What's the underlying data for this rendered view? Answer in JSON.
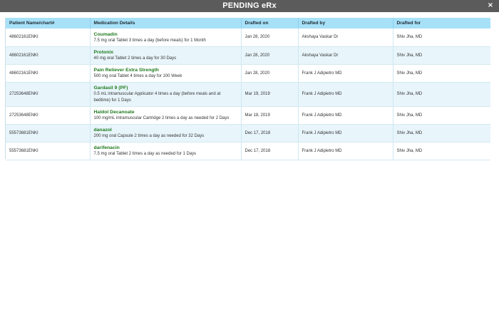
{
  "window": {
    "title": "PENDING eRx",
    "close_glyph": "×",
    "close_icon": "close-icon"
  },
  "table": {
    "columns": [
      "Patient Name/chart#",
      "Medication Details",
      "Drafted on",
      "Drafted by",
      "Drafted for"
    ],
    "rows": [
      {
        "patient": "48602161ENKI",
        "med_name": "Coumadin",
        "med_desc": "7.5 mg oral Tablet 3 times a day (before meals) for 1 Month",
        "drafted_on": "Jan 28, 2020",
        "drafted_by": "Akshaya Vaskar Dr",
        "drafted_for": "Shiv Jha, MD"
      },
      {
        "patient": "48602161ENKI",
        "med_name": "Protonix",
        "med_desc": "40 mg oral Tablet 2 times a day for 30 Days",
        "drafted_on": "Jan 28, 2020",
        "drafted_by": "Akshaya Vaskar Dr",
        "drafted_for": "Shiv Jha, MD"
      },
      {
        "patient": "48602161ENKI",
        "med_name": "Pain Reliever Extra Strength",
        "med_desc": "500 mg oral Tablet 4 times a day for 100 Week",
        "drafted_on": "Jan 28, 2020",
        "drafted_by": "Frank J Adipietro MD",
        "drafted_for": "Shiv Jha, MD"
      },
      {
        "patient": "27253648ENKI",
        "med_name": "Gardasil 9 (PF)",
        "med_desc": "0.5 mL intramuscular Applicator 4 times a day (before meals and at bedtime) for 1 Days",
        "drafted_on": "Mar 19, 2019",
        "drafted_by": "Frank J Adipietro MD",
        "drafted_for": "Shiv Jha, MD"
      },
      {
        "patient": "27253648ENKI",
        "med_name": "Haldol Decanoate",
        "med_desc": "100 mg/mL intramuscular Cartridge 2 times a day as needed for 2 Days",
        "drafted_on": "Mar 18, 2019",
        "drafted_by": "Frank J Adipietro MD",
        "drafted_for": "Shiv Jha, MD"
      },
      {
        "patient": "55573681ENKI",
        "med_name": "danazol",
        "med_desc": "200 mg oral Capsule 2 times a day as needed for 32 Days",
        "drafted_on": "Dec 17, 2018",
        "drafted_by": "Frank J Adipietro MD",
        "drafted_for": "Shiv Jha, MD"
      },
      {
        "patient": "55573681ENKI",
        "med_name": "darifenacin",
        "med_desc": "7.5 mg oral Tablet 2 times a day as needed for 1 Days",
        "drafted_on": "Dec 17, 2018",
        "drafted_by": "Frank J Adipietro MD",
        "drafted_for": "Shiv Jha, MD"
      }
    ]
  },
  "colors": {
    "titlebar": "#5b5b5b",
    "header": "#a7e1f7",
    "row_alt": "#e8f5fb",
    "med_name": "#1e7a1e"
  }
}
